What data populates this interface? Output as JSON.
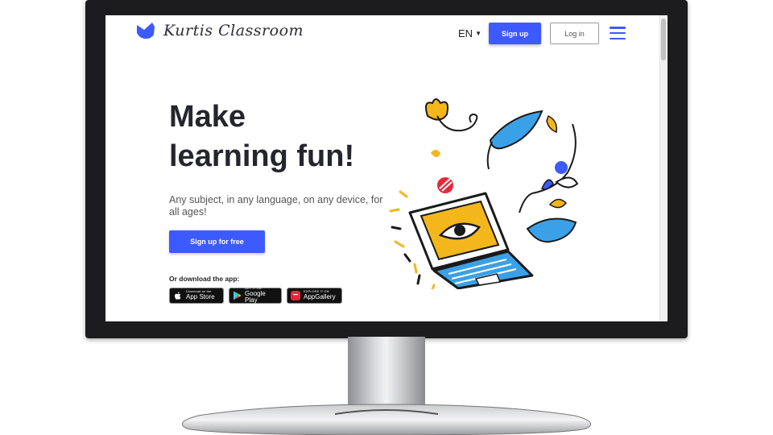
{
  "brand": {
    "name": "Kurtis Classroom",
    "accent": "#3d5afe"
  },
  "header": {
    "language": "EN",
    "signup_label": "Sign up",
    "login_label": "Log in",
    "menu_icon": "hamburger-menu-icon"
  },
  "hero": {
    "title_line1": "Make",
    "title_line2": "learning fun!",
    "subtitle": "Any subject, in any language, on any device, for all ages!",
    "cta_label": "Sign up for free"
  },
  "download": {
    "label": "Or download the app:",
    "stores": [
      {
        "small": "Download on the",
        "big": "App Store",
        "icon": "apple-icon"
      },
      {
        "small": "GET IT ON",
        "big": "Google Play",
        "icon": "google-play-icon"
      },
      {
        "small": "EXPLORE IT ON",
        "big": "AppGallery",
        "icon": "huawei-icon"
      }
    ]
  }
}
